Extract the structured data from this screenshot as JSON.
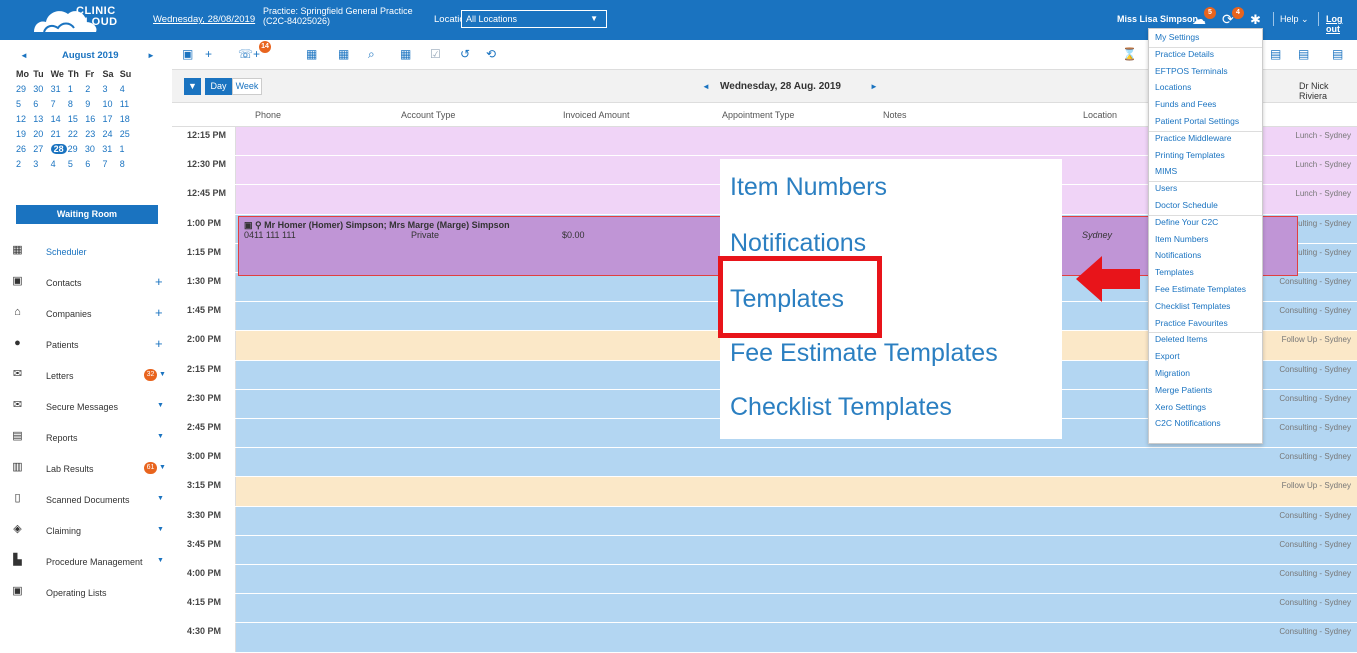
{
  "header": {
    "logo_text_1": "CLINIC",
    "logo_text_2": "CLOUD",
    "date_link": "Wednesday, 28/08/2019",
    "practice_line1": "Practice: Springfield General Practice",
    "practice_line2": "(C2C-84025026)",
    "location_label": "Location:",
    "location_value": "All Locations",
    "user_name": "Miss Lisa Simpson",
    "notif_badge": "5",
    "task_badge": "4",
    "help_label": "Help",
    "logout_label": "Log out"
  },
  "calendar": {
    "title": "August 2019",
    "weekdays": [
      "Mo",
      "Tu",
      "We",
      "Th",
      "Fr",
      "Sa",
      "Su"
    ],
    "weeks": [
      [
        "29",
        "30",
        "31",
        "1",
        "2",
        "3",
        "4"
      ],
      [
        "5",
        "6",
        "7",
        "8",
        "9",
        "10",
        "11"
      ],
      [
        "12",
        "13",
        "14",
        "15",
        "16",
        "17",
        "18"
      ],
      [
        "19",
        "20",
        "21",
        "22",
        "23",
        "24",
        "25"
      ],
      [
        "26",
        "27",
        "28",
        "29",
        "30",
        "31",
        "1"
      ],
      [
        "2",
        "3",
        "4",
        "5",
        "6",
        "7",
        "8"
      ]
    ],
    "selected_day": "28"
  },
  "sidebar": {
    "waiting_room": "Waiting Room",
    "items": [
      {
        "label": "Scheduler"
      },
      {
        "label": "Contacts"
      },
      {
        "label": "Companies"
      },
      {
        "label": "Patients"
      },
      {
        "label": "Letters",
        "badge": "32"
      },
      {
        "label": "Secure Messages"
      },
      {
        "label": "Reports"
      },
      {
        "label": "Lab Results",
        "badge": "61"
      },
      {
        "label": "Scanned Documents"
      },
      {
        "label": "Claiming"
      },
      {
        "label": "Procedure Management"
      },
      {
        "label": "Operating Lists"
      }
    ]
  },
  "toolbar": {
    "call_badge": "14"
  },
  "dayview": {
    "day_label": "Day",
    "week_label": "Week",
    "title": "Wednesday, 28 Aug. 2019",
    "doctor": "Dr Nick Riviera"
  },
  "columns": {
    "phone": "Phone",
    "account_type": "Account Type",
    "invoiced_amount": "Invoiced Amount",
    "appointment_type": "Appointment Type",
    "notes": "Notes",
    "location": "Location"
  },
  "schedule": {
    "rows": [
      {
        "time": "12:15 PM",
        "tag": "Lunch - Sydney",
        "color": "#f0d4f7"
      },
      {
        "time": "12:30 PM",
        "tag": "Lunch - Sydney",
        "color": "#f0d4f7"
      },
      {
        "time": "12:45 PM",
        "tag": "Lunch - Sydney",
        "color": "#f0d4f7"
      },
      {
        "time": "1:00 PM",
        "tag": "Consulting - Sydney",
        "color": "#b3d6f2"
      },
      {
        "time": "1:15 PM",
        "tag": "Consulting - Sydney",
        "color": "#b3d6f2"
      },
      {
        "time": "1:30 PM",
        "tag": "Consulting - Sydney",
        "color": "#b3d6f2"
      },
      {
        "time": "1:45 PM",
        "tag": "Consulting - Sydney",
        "color": "#b3d6f2"
      },
      {
        "time": "2:00 PM",
        "tag": "Follow Up - Sydney",
        "color": "#fbe8c8"
      },
      {
        "time": "2:15 PM",
        "tag": "Consulting - Sydney",
        "color": "#b3d6f2"
      },
      {
        "time": "2:30 PM",
        "tag": "Consulting - Sydney",
        "color": "#b3d6f2"
      },
      {
        "time": "2:45 PM",
        "tag": "Consulting - Sydney",
        "color": "#b3d6f2"
      },
      {
        "time": "3:00 PM",
        "tag": "Consulting - Sydney",
        "color": "#b3d6f2"
      },
      {
        "time": "3:15 PM",
        "tag": "Follow Up - Sydney",
        "color": "#fbe8c8"
      },
      {
        "time": "3:30 PM",
        "tag": "Consulting - Sydney",
        "color": "#b3d6f2"
      },
      {
        "time": "3:45 PM",
        "tag": "Consulting - Sydney",
        "color": "#b3d6f2"
      },
      {
        "time": "4:00 PM",
        "tag": "Consulting - Sydney",
        "color": "#b3d6f2"
      },
      {
        "time": "4:15 PM",
        "tag": "Consulting - Sydney",
        "color": "#b3d6f2"
      },
      {
        "time": "4:30 PM",
        "tag": "Consulting - Sydney",
        "color": "#b3d6f2"
      }
    ]
  },
  "appointment": {
    "names": "Mr Homer (Homer) Simpson;  Mrs Marge (Marge) Simpson",
    "phone": "0411 111 111",
    "account": "Private",
    "amount": "$0.00",
    "location": "Sydney"
  },
  "zoom": {
    "items": [
      "Item Numbers",
      "Notifications",
      "Templates",
      "Fee Estimate Templates",
      "Checklist Templates"
    ]
  },
  "settings_menu": {
    "items": [
      "My Settings",
      "Practice Details",
      "EFTPOS Terminals",
      "Locations",
      "Funds and Fees",
      "Patient Portal Settings",
      "Practice Middleware",
      "Printing Templates",
      "MIMS",
      "Users",
      "Doctor Schedule",
      "Define Your C2C",
      "Item Numbers",
      "Notifications",
      "Templates",
      "Fee Estimate Templates",
      "Checklist Templates",
      "Practice Favourites",
      "Deleted Items",
      "Export",
      "Migration",
      "Merge Patients",
      "Xero Settings",
      "C2C Notifications"
    ]
  }
}
